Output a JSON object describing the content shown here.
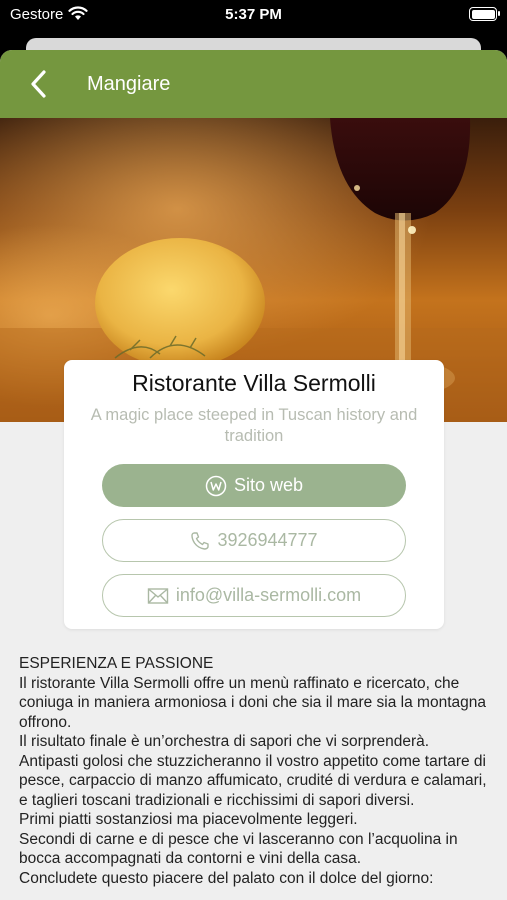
{
  "status_bar": {
    "carrier": "Gestore",
    "time": "5:37 PM",
    "icons": [
      "wifi-icon",
      "battery-icon"
    ]
  },
  "nav": {
    "title": "Mangiare",
    "back_icon": "chevron-left-icon",
    "color": "#75973f"
  },
  "restaurant": {
    "name": "Ristorante Villa Sermolli",
    "tagline": "A magic place steeped in Tuscan history and tradition"
  },
  "buttons": {
    "web": {
      "label": "Sito web",
      "icon": "web-icon",
      "color": "#9bb38f"
    },
    "phone": {
      "label": "3926944777",
      "icon": "phone-icon"
    },
    "email": {
      "label": "info@villa-sermolli.com",
      "icon": "mail-icon"
    }
  },
  "description": {
    "lines": [
      "ESPERIENZA E PASSIONE",
      "Il ristorante Villa Sermolli offre un menù raffinato e ricercato, che coniuga in maniera armoniosa i doni che sia il mare sia la montagna offrono.",
      "Il risultato finale è un’orchestra di sapori che vi sorprenderà.",
      "Antipasti golosi che stuzzicheranno il vostro appetito come tartare di pesce, carpaccio di manzo affumicato, crudité di verdura e calamari, e taglieri toscani tradizionali e ricchissimi di sapori diversi.",
      "Primi piatti sostanziosi ma piacevolmente leggeri.",
      "Secondi di carne e di pesce che vi lasceranno con l’acquolina in bocca accompagnati da contorni e vini della casa.",
      "Concludete questo piacere del palato con il dolce del giorno:"
    ]
  }
}
